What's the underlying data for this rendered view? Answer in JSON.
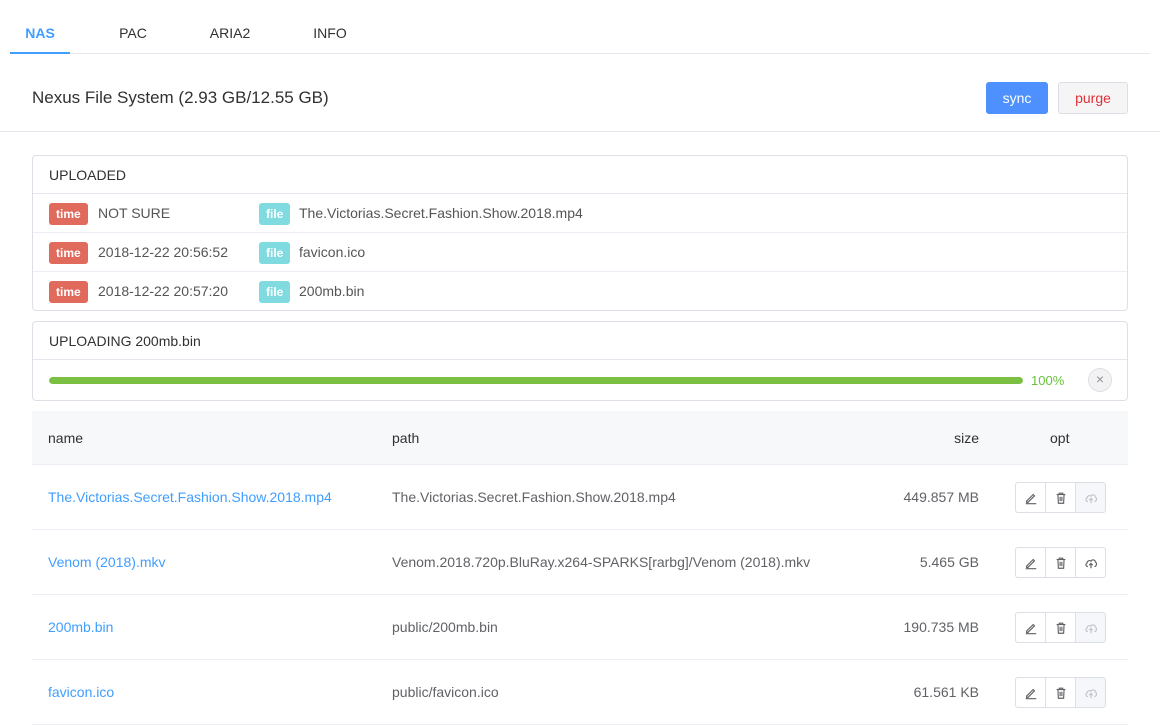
{
  "tabs": [
    {
      "label": "NAS",
      "active": true
    },
    {
      "label": "PAC",
      "active": false
    },
    {
      "label": "ARIA2",
      "active": false
    },
    {
      "label": "INFO",
      "active": false
    }
  ],
  "header": {
    "title": "Nexus File System (2.93 GB/12.55 GB)",
    "sync_label": "sync",
    "purge_label": "purge"
  },
  "uploaded": {
    "title": "UPLOADED",
    "time_tag": "time",
    "file_tag": "file",
    "rows": [
      {
        "time": "NOT SURE",
        "file": "The.Victorias.Secret.Fashion.Show.2018.mp4"
      },
      {
        "time": "2018-12-22 20:56:52",
        "file": "favicon.ico"
      },
      {
        "time": "2018-12-22 20:57:20",
        "file": "200mb.bin"
      }
    ]
  },
  "uploading": {
    "title": "UPLOADING 200mb.bin",
    "progress_fraction": 1.0,
    "progress_label": "100%",
    "cancel_glyph": "×"
  },
  "table": {
    "headers": {
      "name": "name",
      "path": "path",
      "size": "size",
      "opt": "opt"
    },
    "rows": [
      {
        "name": "The.Victorias.Secret.Fashion.Show.2018.mp4",
        "path": "The.Victorias.Secret.Fashion.Show.2018.mp4",
        "size": "449.857 MB",
        "upload_enabled": false
      },
      {
        "name": "Venom (2018).mkv",
        "path": "Venom.2018.720p.BluRay.x264-SPARKS[rarbg]/Venom (2018).mkv",
        "size": "5.465 GB",
        "upload_enabled": true
      },
      {
        "name": "200mb.bin",
        "path": "public/200mb.bin",
        "size": "190.735 MB",
        "upload_enabled": false
      },
      {
        "name": "favicon.ico",
        "path": "public/favicon.ico",
        "size": "61.561 KB",
        "upload_enabled": false
      }
    ]
  },
  "icons": {
    "edit": "edit-icon",
    "delete": "trash-icon",
    "upload": "cloud-upload-icon",
    "cancel": "close-circle-icon"
  },
  "colors": {
    "primary": "#409eff",
    "danger": "#e0303a",
    "success": "#67c23a",
    "tag_time": "#e06b5d",
    "tag_file": "#7fdbe0"
  }
}
